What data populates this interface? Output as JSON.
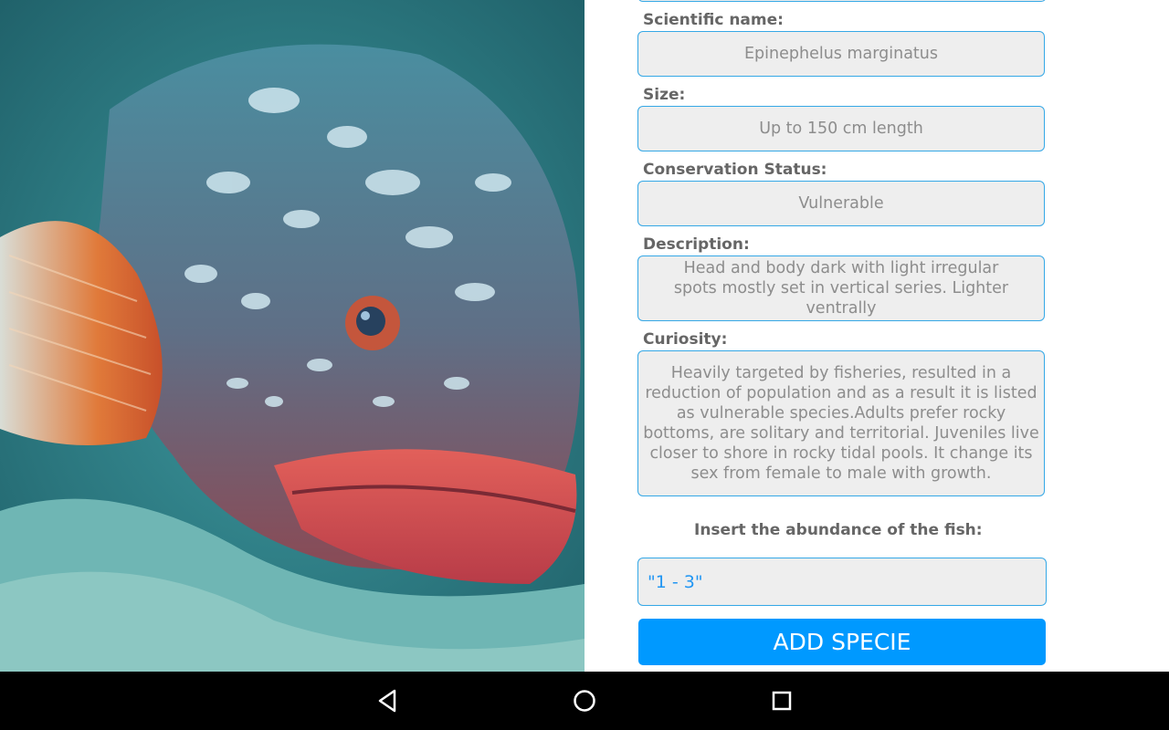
{
  "image": {
    "subject": "dusky grouper fish photo"
  },
  "fields": {
    "scientific_name": {
      "label": "Scientific name:",
      "value": "Epinephelus marginatus"
    },
    "size": {
      "label": "Size:",
      "value": "Up to 150 cm length"
    },
    "conservation_status": {
      "label": "Conservation Status:",
      "value": "Vulnerable"
    },
    "description": {
      "label": "Description:",
      "value": "Head and body dark with light irregular spots mostly set in vertical series.  Lighter ventrally"
    },
    "curiosity": {
      "label": "Curiosity:",
      "value": "Heavily targeted by fisheries, resulted in a reduction of population and as a result it is listed as vulnerable species.Adults prefer rocky bottoms, are solitary and territorial. Juveniles live closer to shore in rocky tidal pools.  It change its sex from female to male with growth."
    }
  },
  "abundance": {
    "prompt": "Insert the abundance of the fish:",
    "value": "\"1 - 3\""
  },
  "add_button": {
    "label": "ADD SPECIE"
  },
  "navbar": {
    "back": "back-icon",
    "home": "home-icon",
    "recents": "recents-icon"
  },
  "colors": {
    "accent": "#0099ff",
    "field_border": "#35a8e6",
    "field_bg": "#eeeeee",
    "label": "#666666",
    "value_text": "#8d8d8d"
  }
}
